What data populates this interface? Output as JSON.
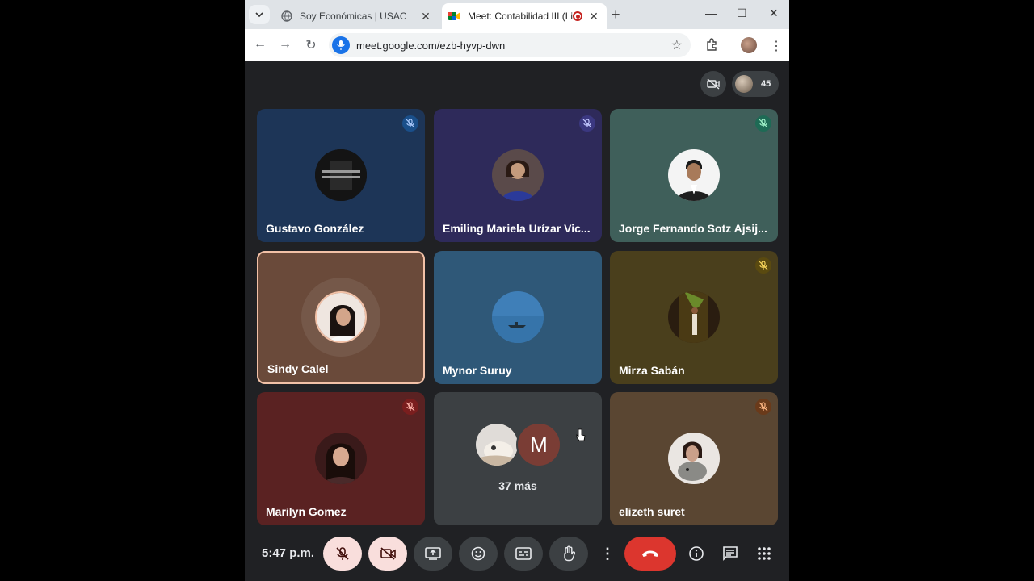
{
  "browser": {
    "tabs": [
      {
        "title": "Soy Económicas | USAC",
        "active": false
      },
      {
        "title": "Meet: Contabilidad III (Lic. M",
        "active": true
      }
    ],
    "url": "meet.google.com/ezb-hyvp-dwn"
  },
  "meet": {
    "participant_count": "45",
    "tiles": [
      {
        "name": "Gustavo González",
        "bg": "#1d3557",
        "muted": true
      },
      {
        "name": "Emiling Mariela Urízar Vic...",
        "bg": "#2e2a5a",
        "muted": true
      },
      {
        "name": "Jorge Fernando Sotz Ajsij...",
        "bg": "#3f5f5a",
        "muted": true
      },
      {
        "name": "Sindy Calel",
        "bg": "#6a4a3a",
        "muted": false,
        "speaking": true
      },
      {
        "name": "Mynor Suruy",
        "bg": "#2f5878",
        "muted": false
      },
      {
        "name": "Mirza Sabán",
        "bg": "#4a3f1c",
        "muted": true
      },
      {
        "name": "Marilyn Gomez",
        "bg": "#5a2222",
        "muted": true
      },
      {
        "name": "",
        "bg": "#3c4043",
        "muted": false,
        "more_label": "37 más",
        "initial": "M"
      },
      {
        "name": "elizeth suret",
        "bg": "#5a4632",
        "muted": true
      }
    ],
    "clock": "5:47 p.m."
  },
  "icons": [
    "search-icon",
    "globe-icon",
    "meet-icon",
    "record-icon",
    "close-icon",
    "plus-icon",
    "minimize-icon",
    "maximize-icon",
    "back-icon",
    "forward-icon",
    "reload-icon",
    "mic-icon",
    "star-icon",
    "extensions-icon",
    "more-vertical-icon",
    "mic-off-icon",
    "camera-off-icon",
    "present-icon",
    "emoji-icon",
    "captions-icon",
    "raise-hand-icon",
    "end-call-icon",
    "info-icon",
    "chat-icon",
    "apps-icon"
  ]
}
